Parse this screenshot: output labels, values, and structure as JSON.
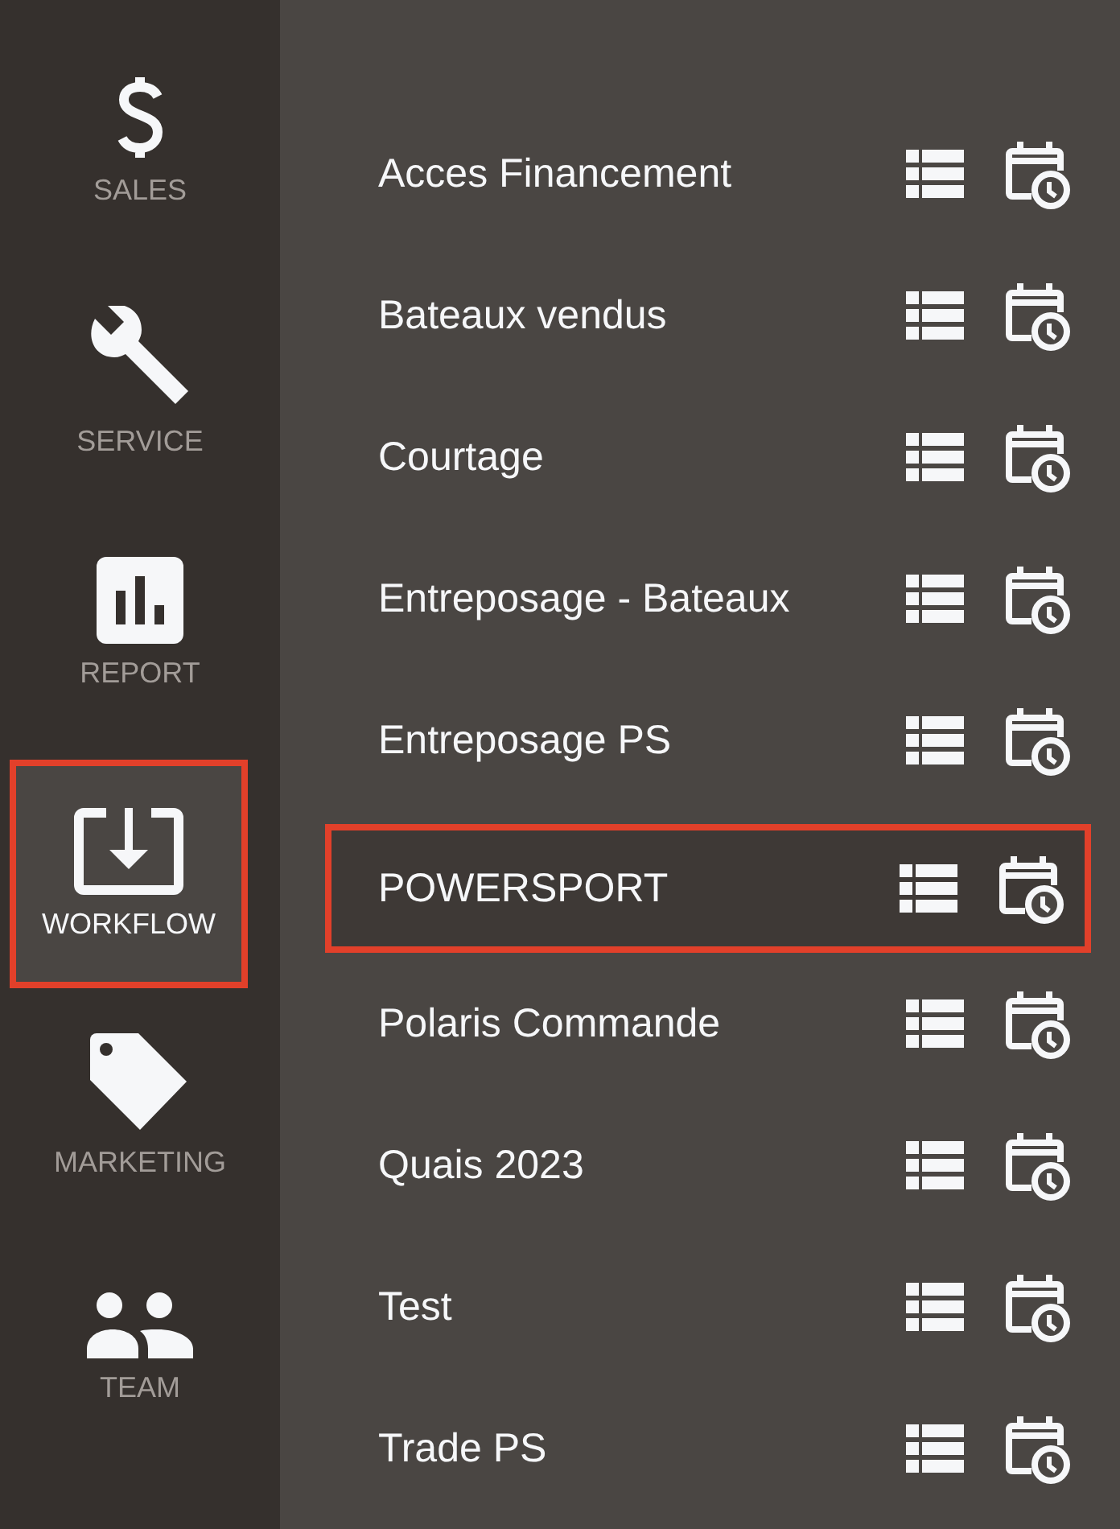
{
  "sidebar": {
    "items": [
      {
        "kind": "sales",
        "label": "SALES",
        "selected": false
      },
      {
        "kind": "service",
        "label": "SERVICE",
        "selected": false
      },
      {
        "kind": "report",
        "label": "REPORT",
        "selected": false
      },
      {
        "kind": "workflow",
        "label": "WORKFLOW",
        "selected": true
      },
      {
        "kind": "marketing",
        "label": "MARKETING",
        "selected": false
      },
      {
        "kind": "team",
        "label": "TEAM",
        "selected": false
      }
    ]
  },
  "workflows": [
    {
      "name": "Acces Financement",
      "selected": false
    },
    {
      "name": "Bateaux vendus",
      "selected": false
    },
    {
      "name": "Courtage",
      "selected": false
    },
    {
      "name": "Entreposage - Bateaux",
      "selected": false
    },
    {
      "name": "Entreposage PS",
      "selected": false
    },
    {
      "name": "POWERSPORT",
      "selected": true
    },
    {
      "name": "Polaris Commande",
      "selected": false
    },
    {
      "name": "Quais 2023",
      "selected": false
    },
    {
      "name": "Test",
      "selected": false
    },
    {
      "name": "Trade PS",
      "selected": false
    }
  ]
}
